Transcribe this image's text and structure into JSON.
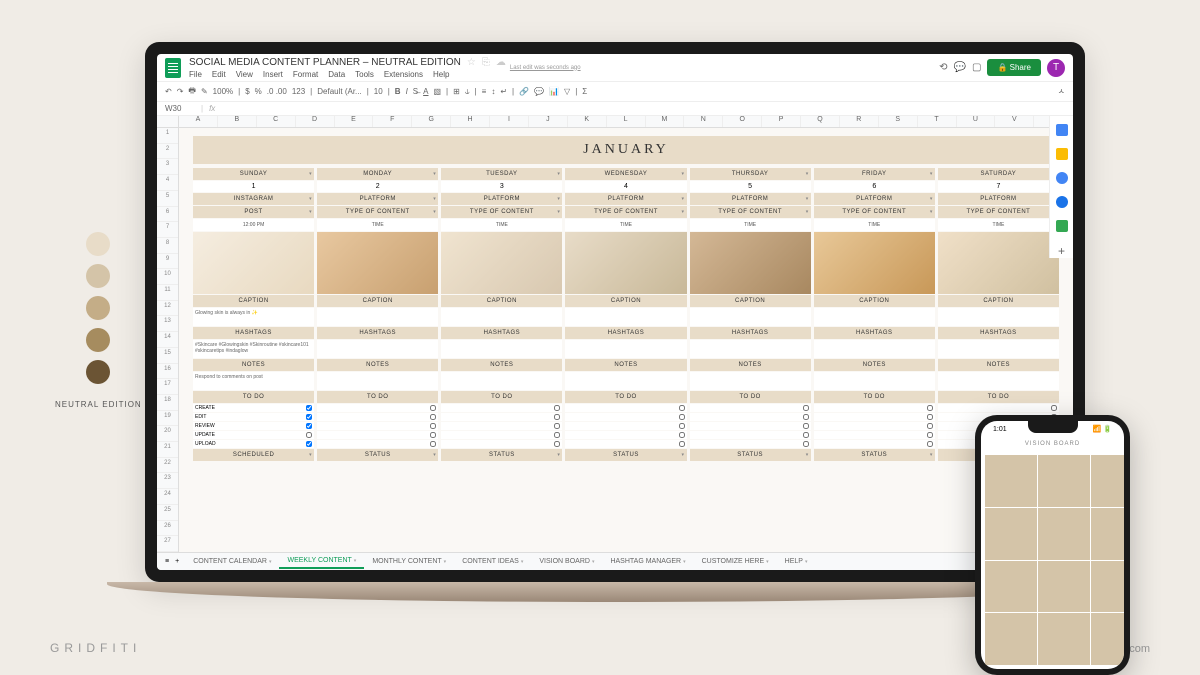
{
  "palette": {
    "colors": [
      "#e8dcc8",
      "#d4c4a8",
      "#c4ad87",
      "#a68c5f",
      "#6b5434"
    ],
    "label": "NEUTRAL EDITION"
  },
  "brand": "GRIDFITI",
  "site_url": "gridfiti.com",
  "doc": {
    "title": "SOCIAL MEDIA CONTENT PLANNER – NEUTRAL EDITION",
    "last_edit": "Last edit was seconds ago",
    "menu": [
      "File",
      "Edit",
      "View",
      "Insert",
      "Format",
      "Data",
      "Tools",
      "Extensions",
      "Help"
    ],
    "share_label": "Share",
    "avatar_letter": "T"
  },
  "toolbar": {
    "zoom": "100%",
    "currency": "$",
    "percent": "%",
    "decimals": ".0 .00",
    "decimal_label": "123",
    "font": "Default (Ar...",
    "font_size": "10"
  },
  "cell_ref": "W30",
  "columns": [
    "A",
    "B",
    "C",
    "D",
    "E",
    "F",
    "G",
    "H",
    "I",
    "J",
    "K",
    "L",
    "M",
    "N",
    "O",
    "P",
    "Q",
    "R",
    "S",
    "T",
    "U",
    "V",
    "W"
  ],
  "month": "JANUARY",
  "days": [
    {
      "name": "SUNDAY",
      "date": "1",
      "platform": "INSTAGRAM",
      "content_type": "POST",
      "time": "12:00 PM",
      "caption": "Glowing skin is always in ✨",
      "hashtags": "#Skincare #Glowingskin #Skinroutine #skincare101 #skincaretips #indaglow",
      "notes": "Respond to comments on post",
      "status": "SCHEDULED",
      "todos": [
        {
          "label": "CREATE",
          "done": true
        },
        {
          "label": "EDIT",
          "done": true
        },
        {
          "label": "REVIEW",
          "done": true
        },
        {
          "label": "UPDATE",
          "done": false
        },
        {
          "label": "UPLOAD",
          "done": true
        }
      ]
    },
    {
      "name": "MONDAY",
      "date": "2",
      "platform": "PLATFORM",
      "content_type": "TYPE OF CONTENT",
      "time": "TIME",
      "caption": "",
      "hashtags": "",
      "notes": "",
      "status": "STATUS",
      "todos": [
        {
          "label": "",
          "done": false
        },
        {
          "label": "",
          "done": false
        },
        {
          "label": "",
          "done": false
        },
        {
          "label": "",
          "done": false
        },
        {
          "label": "",
          "done": false
        }
      ]
    },
    {
      "name": "TUESDAY",
      "date": "3",
      "platform": "PLATFORM",
      "content_type": "TYPE OF CONTENT",
      "time": "TIME",
      "caption": "",
      "hashtags": "",
      "notes": "",
      "status": "STATUS",
      "todos": [
        {
          "label": "",
          "done": false
        },
        {
          "label": "",
          "done": false
        },
        {
          "label": "",
          "done": false
        },
        {
          "label": "",
          "done": false
        },
        {
          "label": "",
          "done": false
        }
      ]
    },
    {
      "name": "WEDNESDAY",
      "date": "4",
      "platform": "PLATFORM",
      "content_type": "TYPE OF CONTENT",
      "time": "TIME",
      "caption": "",
      "hashtags": "",
      "notes": "",
      "status": "STATUS",
      "todos": [
        {
          "label": "",
          "done": false
        },
        {
          "label": "",
          "done": false
        },
        {
          "label": "",
          "done": false
        },
        {
          "label": "",
          "done": false
        },
        {
          "label": "",
          "done": false
        }
      ]
    },
    {
      "name": "THURSDAY",
      "date": "5",
      "platform": "PLATFORM",
      "content_type": "TYPE OF CONTENT",
      "time": "TIME",
      "caption": "",
      "hashtags": "",
      "notes": "",
      "status": "STATUS",
      "todos": [
        {
          "label": "",
          "done": false
        },
        {
          "label": "",
          "done": false
        },
        {
          "label": "",
          "done": false
        },
        {
          "label": "",
          "done": false
        },
        {
          "label": "",
          "done": false
        }
      ]
    },
    {
      "name": "FRIDAY",
      "date": "6",
      "platform": "PLATFORM",
      "content_type": "TYPE OF CONTENT",
      "time": "TIME",
      "caption": "",
      "hashtags": "",
      "notes": "",
      "status": "STATUS",
      "todos": [
        {
          "label": "",
          "done": false
        },
        {
          "label": "",
          "done": false
        },
        {
          "label": "",
          "done": false
        },
        {
          "label": "",
          "done": false
        },
        {
          "label": "",
          "done": false
        }
      ]
    },
    {
      "name": "SATURDAY",
      "date": "7",
      "platform": "PLATFORM",
      "content_type": "TYPE OF CONTENT",
      "time": "TIME",
      "caption": "",
      "hashtags": "",
      "notes": "",
      "status": "STATUS",
      "todos": [
        {
          "label": "",
          "done": false
        },
        {
          "label": "",
          "done": false
        },
        {
          "label": "",
          "done": false
        },
        {
          "label": "",
          "done": false
        },
        {
          "label": "",
          "done": false
        }
      ]
    }
  ],
  "section_labels": {
    "caption": "CAPTION",
    "hashtags": "HASHTAGS",
    "notes": "NOTES",
    "todo": "TO DO",
    "status": "STATUS"
  },
  "tabs": [
    "CONTENT CALENDAR",
    "WEEKLY CONTENT",
    "MONTHLY CONTENT",
    "CONTENT IDEAS",
    "VISION BOARD",
    "HASHTAG MANAGER",
    "CUSTOMIZE HERE",
    "HELP"
  ],
  "active_tab": 1,
  "phone": {
    "time": "1:01",
    "header": "VISION BOARD"
  }
}
